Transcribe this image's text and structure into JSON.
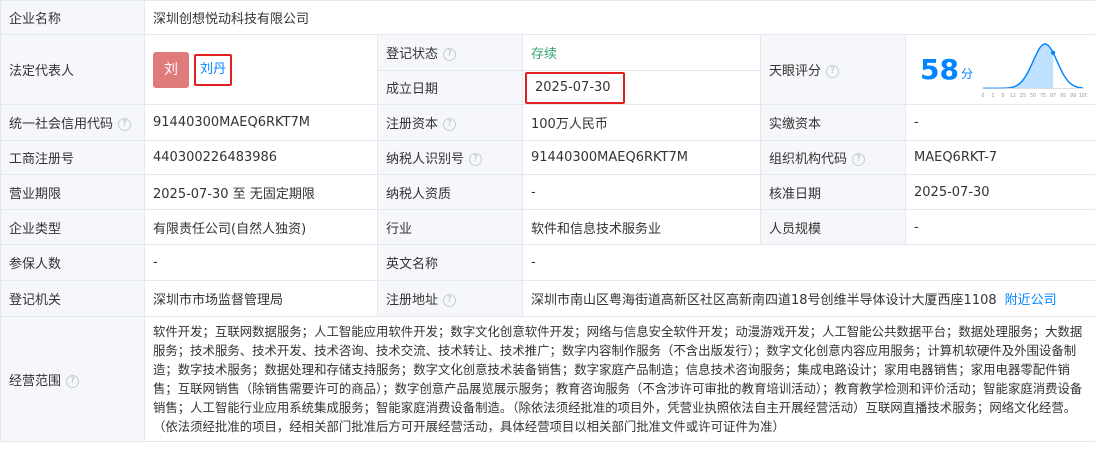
{
  "company": {
    "name_label": "企业名称",
    "name": "深圳创想悦动科技有限公司"
  },
  "legal_rep": {
    "label": "法定代表人",
    "avatar_char": "刘",
    "name": "刘丹"
  },
  "reg_status": {
    "label": "登记状态",
    "value": "存续"
  },
  "found_date": {
    "label": "成立日期",
    "value": "2025-07-30"
  },
  "tianyan": {
    "label": "天眼评分",
    "score": "58",
    "unit": "分",
    "axis_ticks": [
      "0",
      "1",
      "5",
      "12",
      "25",
      "50",
      "75",
      "87",
      "95",
      "99",
      "100"
    ],
    "curve_color": "#0084ff",
    "score_percent": 58
  },
  "rows": [
    {
      "c1_label": "统一社会信用代码",
      "c1_help": true,
      "c1_value": "91440300MAEQ6RKT7M",
      "c2_label": "注册资本",
      "c2_help": true,
      "c2_value": "100万人民币",
      "c3_label": "实缴资本",
      "c3_help": false,
      "c3_value": "-"
    },
    {
      "c1_label": "工商注册号",
      "c1_help": false,
      "c1_value": "440300226483986",
      "c2_label": "纳税人识别号",
      "c2_help": true,
      "c2_value": "91440300MAEQ6RKT7M",
      "c3_label": "组织机构代码",
      "c3_help": true,
      "c3_value": "MAEQ6RKT-7"
    },
    {
      "c1_label": "营业期限",
      "c1_help": false,
      "c1_value": "2025-07-30 至 无固定期限",
      "c2_label": "纳税人资质",
      "c2_help": false,
      "c2_value": "-",
      "c3_label": "核准日期",
      "c3_help": false,
      "c3_value": "2025-07-30"
    },
    {
      "c1_label": "企业类型",
      "c1_help": false,
      "c1_value": "有限责任公司(自然人独资)",
      "c2_label": "行业",
      "c2_help": false,
      "c2_value": "软件和信息技术服务业",
      "c3_label": "人员规模",
      "c3_help": false,
      "c3_value": "-"
    }
  ],
  "insured": {
    "label": "参保人数",
    "value": "-"
  },
  "english_name": {
    "label": "英文名称",
    "value": "-"
  },
  "reg_authority": {
    "label": "登记机关",
    "value": "深圳市市场监督管理局"
  },
  "reg_address": {
    "label": "注册地址",
    "value": "深圳市南山区粤海街道高新区社区高新南四道18号创维半导体设计大厦西座1108",
    "nearby_link": "附近公司"
  },
  "scope": {
    "label": "经营范围",
    "value": "软件开发；互联网数据服务；人工智能应用软件开发；数字文化创意软件开发；网络与信息安全软件开发；动漫游戏开发；人工智能公共数据平台；数据处理服务；大数据服务；技术服务、技术开发、技术咨询、技术交流、技术转让、技术推广；数字内容制作服务（不含出版发行）；数字文化创意内容应用服务；计算机软硬件及外围设备制造；数字技术服务；数据处理和存储支持服务；数字文化创意技术装备销售；数字家庭产品制造；信息技术咨询服务；集成电路设计；家用电器销售；家用电器零配件销售；互联网销售（除销售需要许可的商品）；数字创意产品展览展示服务；教育咨询服务（不含涉许可审批的教育培训活动）；教育教学检测和评价活动；智能家庭消费设备销售；人工智能行业应用系统集成服务；智能家庭消费设备制造。（除依法须经批准的项目外，凭营业执照依法自主开展经营活动）互联网直播技术服务；网络文化经营。（依法须经批准的项目，经相关部门批准后方可开展经营活动，具体经营项目以相关部门批准文件或许可证件为准）"
  }
}
